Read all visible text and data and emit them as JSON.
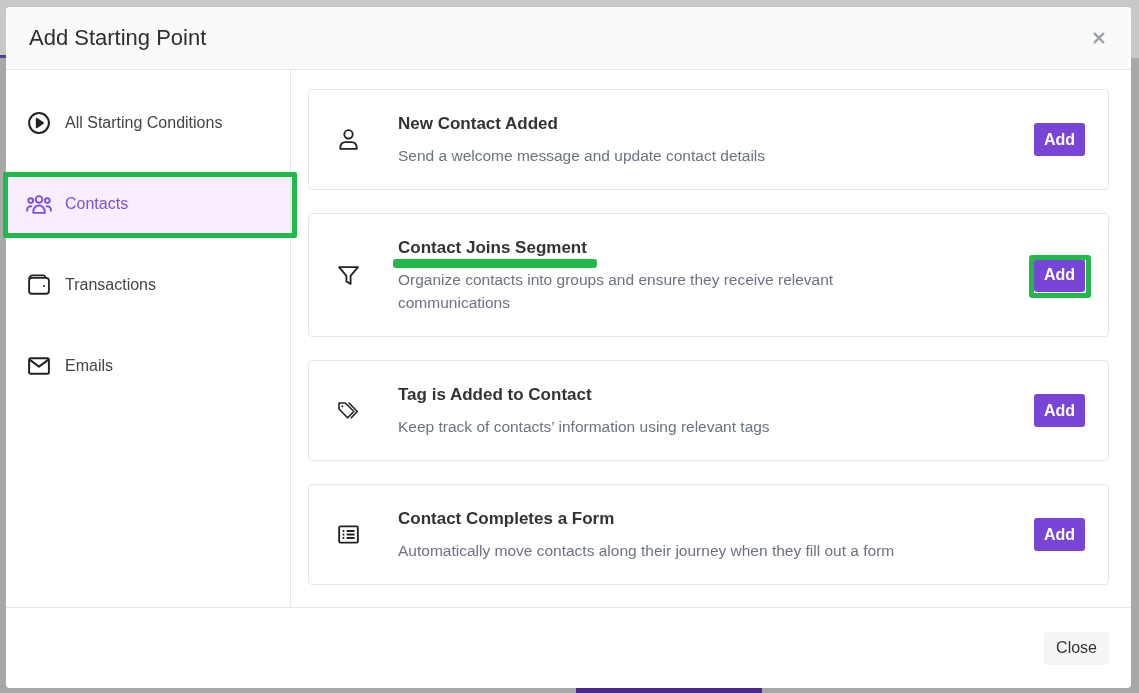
{
  "dialog": {
    "title": "Add Starting Point"
  },
  "sidebar": {
    "items": [
      {
        "label": "All Starting Conditions",
        "selected": false,
        "highlighted": false
      },
      {
        "label": "Contacts",
        "selected": true,
        "highlighted": true
      },
      {
        "label": "Transactions",
        "selected": false,
        "highlighted": false
      },
      {
        "label": "Emails",
        "selected": false,
        "highlighted": false
      }
    ]
  },
  "cards": [
    {
      "title": "New Contact Added",
      "description": "Send a welcome message and update contact details",
      "button": "Add",
      "highlighted": false
    },
    {
      "title": "Contact Joins Segment",
      "description": "Organize contacts into groups and ensure they receive relevant communications",
      "button": "Add",
      "highlighted": true
    },
    {
      "title": "Tag is Added to Contact",
      "description": "Keep track of contacts’ information using relevant tags",
      "button": "Add",
      "highlighted": false
    },
    {
      "title": "Contact Completes a Form",
      "description": "Automatically move contacts along their journey when they fill out a form",
      "button": "Add",
      "highlighted": false
    }
  ],
  "footer": {
    "close_button": "Close"
  }
}
